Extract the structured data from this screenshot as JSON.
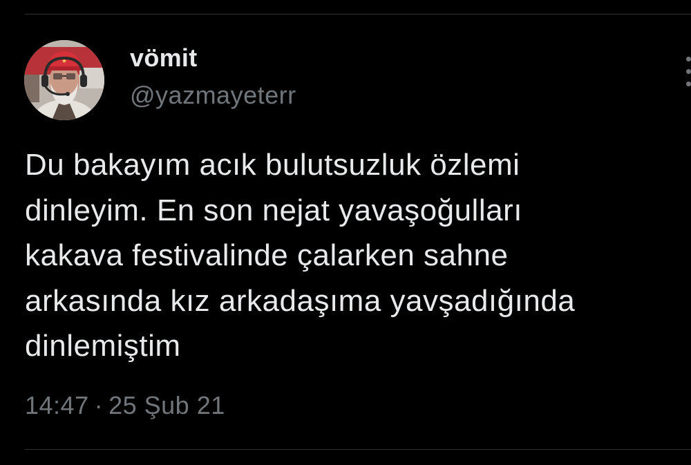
{
  "tweet": {
    "author": {
      "display_name": "vömit",
      "handle": "@yazmayeterr"
    },
    "text_lines": [
      "Du bakayım acık bulutsuzluk özlemi",
      "dinleyim. En son nejat yavaşoğulları",
      "kakava festivalinde çalarken sahne",
      "arkasında kız arkadaşıma yavşadığında",
      "dinlemiştim"
    ],
    "time": "14:47",
    "separator": "·",
    "date": "25 Şub 21"
  },
  "icons": {
    "more": "more-dots-icon"
  },
  "colors": {
    "background": "#000000",
    "primary_text": "#e7e9ea",
    "secondary_text": "#71767b",
    "divider": "#2f3336"
  }
}
